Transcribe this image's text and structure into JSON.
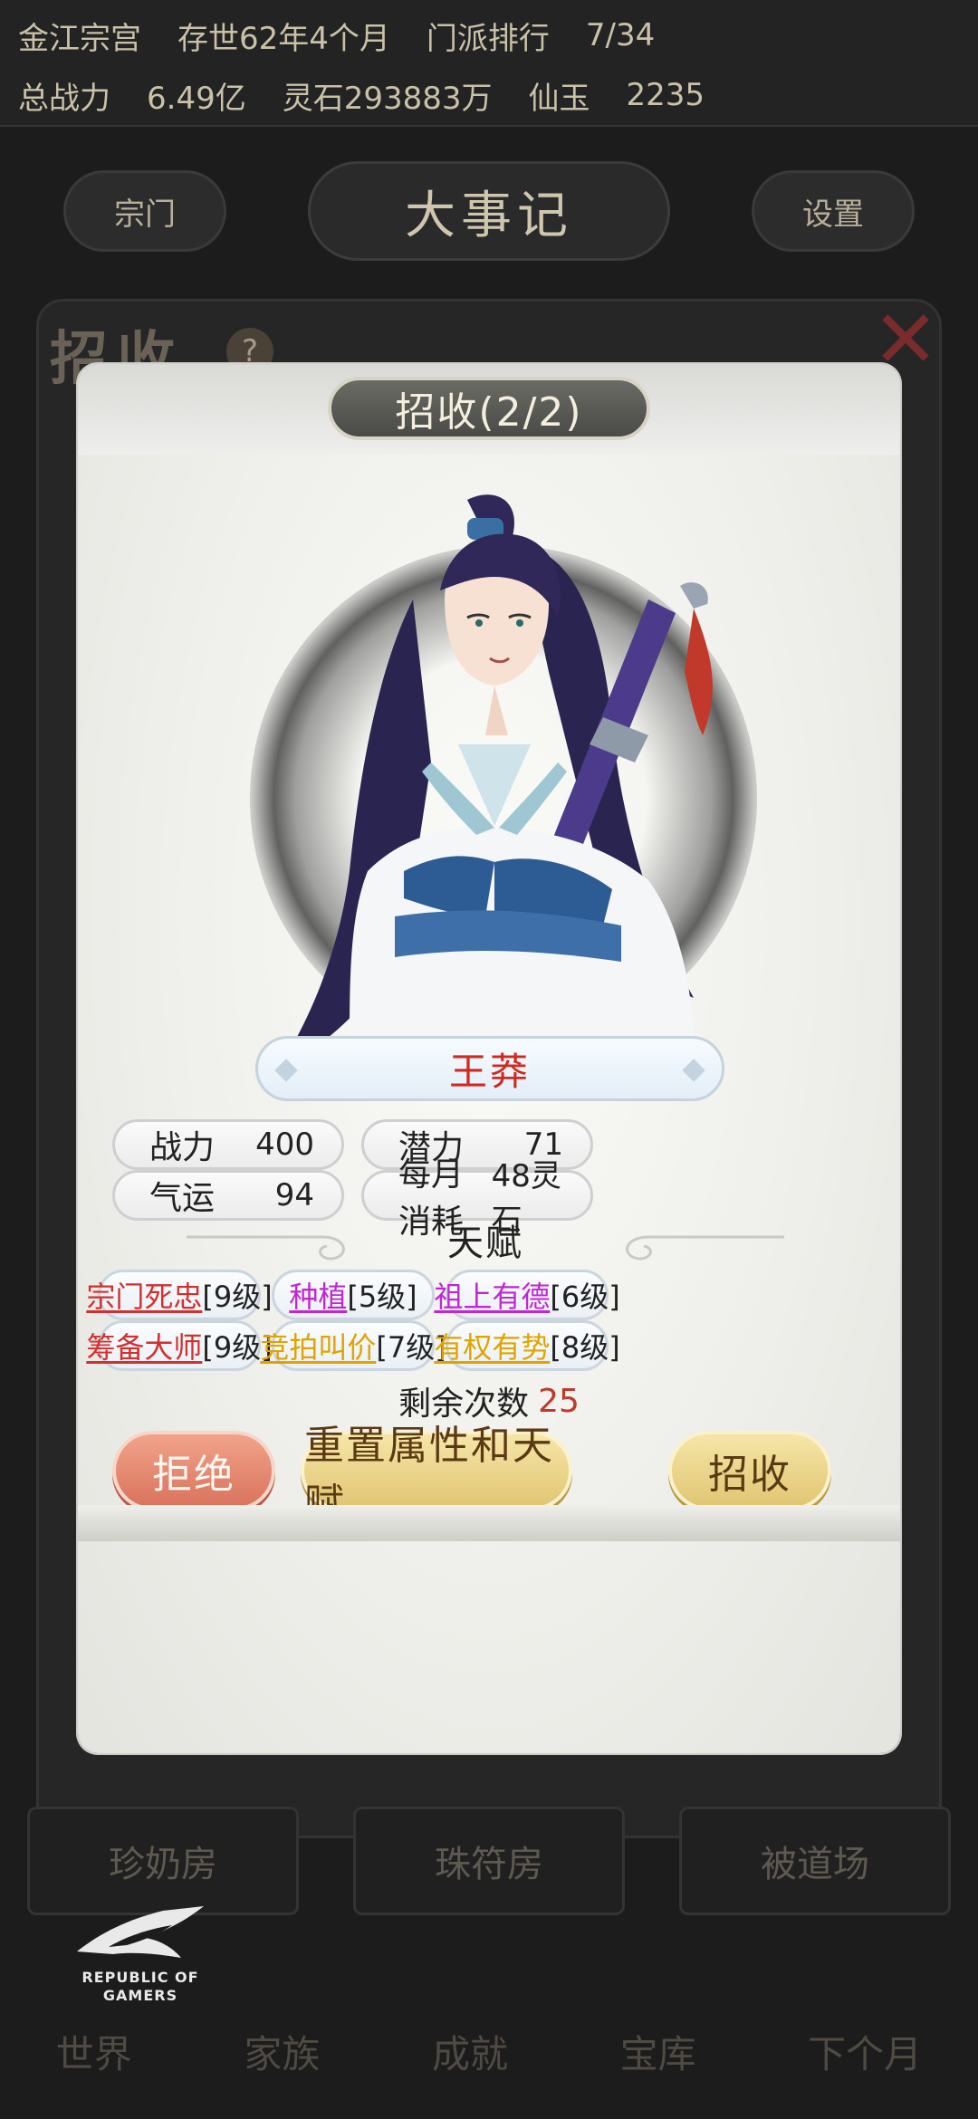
{
  "background": {
    "status_row1": [
      "金江宗宫",
      "存世62年4个月",
      "门派排行",
      "7/34"
    ],
    "status_row2": [
      "总战力",
      "6.49亿",
      "灵石293883万",
      "仙玉",
      "2235"
    ],
    "nav_left": "宗门",
    "nav_title": "大事记",
    "nav_right": "设置",
    "panel_title": "招收",
    "help_icon_text": "?",
    "rooms": [
      "珍奶房",
      "珠符房",
      "被道场"
    ],
    "bottom_nav": [
      "世界",
      "家族",
      "成就",
      "宝库",
      "下个月"
    ],
    "rog_text": "REPUBLIC OF GAMERS"
  },
  "modal": {
    "title": "招收(2/2)",
    "disciple_name": "王莽",
    "stats": [
      {
        "label": "战力",
        "value": "400"
      },
      {
        "label": "潜力",
        "value": "71"
      },
      {
        "label": "气运",
        "value": "94"
      },
      {
        "label": "每月消耗",
        "value": "48灵石"
      }
    ],
    "talent_heading": "天赋",
    "talents": [
      {
        "name": "宗门死忠",
        "level": "[9级]",
        "color": "#d32f2f"
      },
      {
        "name": "种植",
        "level": "[5级]",
        "color": "#c026d3"
      },
      {
        "name": "祖上有德",
        "level": "[6级]",
        "color": "#c026d3"
      },
      {
        "name": "筹备大师",
        "level": "[9级]",
        "color": "#d32f2f"
      },
      {
        "name": "竞拍叫价",
        "level": "[7级]",
        "color": "#e0a400"
      },
      {
        "name": "有权有势",
        "level": "[8级]",
        "color": "#e0a400"
      }
    ],
    "remaining_label": "剩余次数",
    "remaining_count": "25",
    "buttons": {
      "reject": "拒绝",
      "reset": "重置属性和天赋",
      "accept": "招收"
    }
  }
}
